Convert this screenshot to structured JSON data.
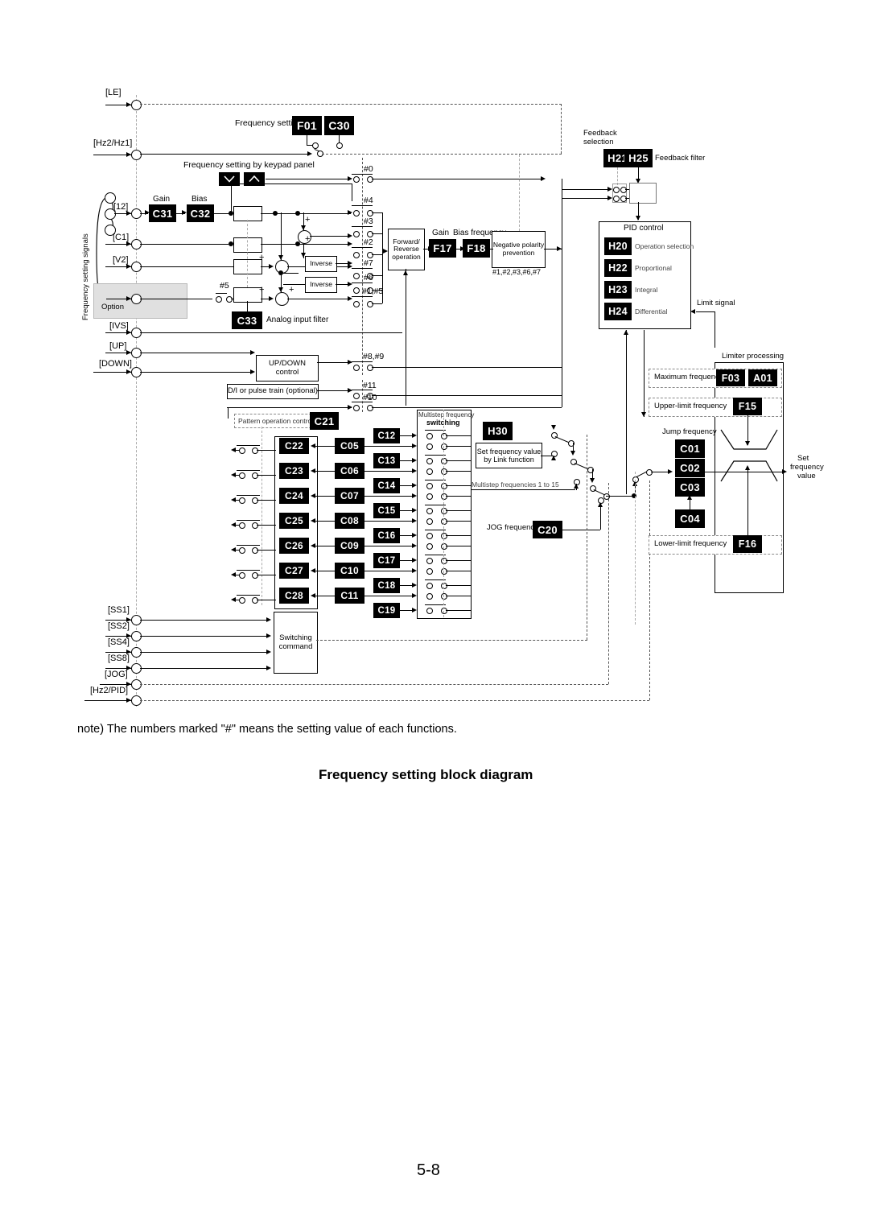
{
  "page": {
    "note": "note) The numbers marked \"#\" means the setting value of each functions.",
    "title": "Frequency setting block diagram",
    "page_number": "5-8"
  },
  "diagram": {
    "group_label": "Frequency setting signals",
    "terminals": [
      {
        "name": "LE",
        "label": "[LE]"
      },
      {
        "name": "Hz2Hz1",
        "label": "[Hz2/Hz1]"
      },
      {
        "name": "12",
        "label": "[12]"
      },
      {
        "name": "C1",
        "label": "[C1]"
      },
      {
        "name": "V2",
        "label": "[V2]"
      },
      {
        "name": "option",
        "label": "Option"
      },
      {
        "name": "IVS",
        "label": "[IVS]"
      },
      {
        "name": "UP",
        "label": "[UP]"
      },
      {
        "name": "DOWN",
        "label": "[DOWN]"
      },
      {
        "name": "SS1",
        "label": "[SS1]"
      },
      {
        "name": "SS2",
        "label": "[SS2]"
      },
      {
        "name": "SS4",
        "label": "[SS4]"
      },
      {
        "name": "SS8",
        "label": "[SS8]"
      },
      {
        "name": "JOG",
        "label": "[JOG]"
      },
      {
        "name": "Hz2PID",
        "label": "[Hz2/PID]"
      }
    ],
    "labels": {
      "frequency_setting": "Frequency setting",
      "keypad": "Frequency setting by keypad panel",
      "gain": "Gain",
      "bias": "Bias",
      "analog_input_filter": "Analog input filter",
      "inverse": "Inverse",
      "forward_reverse": "Forward/\nReverse\noperation",
      "gain2": "Gain",
      "bias_frequency": "Bias frequency",
      "negative_polarity": "Negative polarity\nprevention",
      "negative_polarity_note": "#1,#2,#3,#6,#7",
      "updown_control": "UP/DOWN control",
      "di_pulse_train": "D/I or pulse train (optional)",
      "pattern_operation_control": "Pattern operation control",
      "multistep_switching": "Multistep frequency\nswitching",
      "multistep_switching_l1": "Multistep frequency",
      "multistep_switching_l2": "switching",
      "set_freq_link": "Set frequency value\nby Link function",
      "set_freq_link_l1": "Set frequency value",
      "set_freq_link_l2": "by Link function",
      "multistep_1to15": "Multistep frequencies 1 to 15",
      "jog_frequency": "JOG frequency",
      "switching_command": "Switching\ncommand",
      "switching_command_l1": "Switching",
      "switching_command_l2": "command",
      "feedback_selection": "Feedback\nselection",
      "feedback_selection_l1": "Feedback",
      "feedback_selection_l2": "selection",
      "feedback_filter": "Feedback filter",
      "pid_control": "PID control",
      "pid_operation_selection": "Operation selection",
      "pid_proportional": "Proportional",
      "pid_integral": "Integral",
      "pid_differential": "Differential",
      "limit_signal": "Limit signal",
      "limiter_processing": "Limiter processing",
      "maximum_frequency": "Maximum frequency",
      "upper_limit_frequency": "Upper-limit frequency",
      "lower_limit_frequency": "Lower-limit frequency",
      "jump_frequency": "Jump frequency",
      "set_frequency_value": "Set\nfrequency\nvalue",
      "set_frequency_value_l1": "Set",
      "set_frequency_value_l2": "frequency",
      "set_frequency_value_l3": "value"
    },
    "codes": {
      "F01": "F01",
      "C30": "C30",
      "C31": "C31",
      "C32": "C32",
      "C33": "C33",
      "F17": "F17",
      "F18": "F18",
      "H21": "H21",
      "H25": "H25",
      "H20": "H20",
      "H22": "H22",
      "H23": "H23",
      "H24": "H24",
      "H30": "H30",
      "F03": "F03",
      "A01": "A01",
      "F15": "F15",
      "F16": "F16",
      "C01": "C01",
      "C02": "C02",
      "C03": "C03",
      "C04": "C04",
      "C20": "C20",
      "C21": "C21",
      "C05": "C05",
      "C06": "C06",
      "C07": "C07",
      "C08": "C08",
      "C09": "C09",
      "C10": "C10",
      "C11": "C11",
      "C12": "C12",
      "C13": "C13",
      "C14": "C14",
      "C15": "C15",
      "C16": "C16",
      "C17": "C17",
      "C18": "C18",
      "C19": "C19",
      "C22": "C22",
      "C23": "C23",
      "C24": "C24",
      "C25": "C25",
      "C26": "C26",
      "C27": "C27",
      "C28": "C28"
    },
    "setting_numbers": {
      "n0": "#0",
      "n4": "#4",
      "n3": "#3",
      "n2": "#2",
      "n7": "#7",
      "n6": "#6",
      "n1_5": "#1,#5",
      "n5": "#5",
      "n8_9": "#8,#9",
      "n11": "#11",
      "n10": "#10"
    },
    "plus_signs": [
      "+",
      "+",
      "+",
      "+",
      "+"
    ]
  }
}
